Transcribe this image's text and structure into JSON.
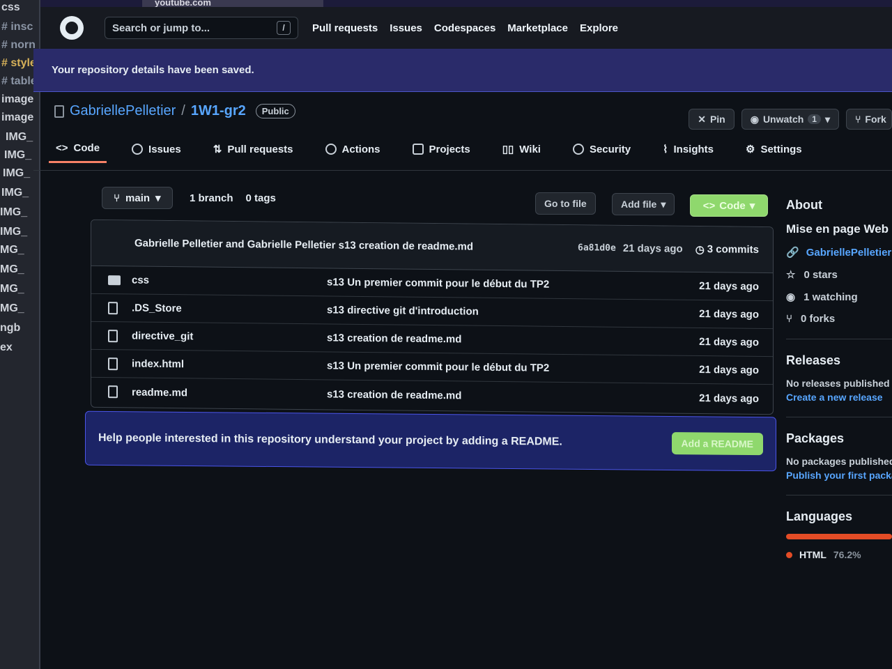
{
  "editor": {
    "lines": [
      "css",
      "# insc",
      "# norn",
      "# style",
      "# table",
      "image",
      "image",
      "IMG_",
      "IMG_",
      "IMG_",
      "IMG_",
      "IMG_",
      "IMG_",
      "MG_",
      "MG_",
      "MG_",
      "MG_",
      "ngb",
      "ex"
    ]
  },
  "browser": {
    "tab_popup": "youtube.com"
  },
  "header": {
    "search_placeholder": "Search or jump to...",
    "search_shortcut": "/",
    "nav": [
      "Pull requests",
      "Issues",
      "Codespaces",
      "Marketplace",
      "Explore"
    ]
  },
  "flash": {
    "message": "Your repository details have been saved."
  },
  "repo": {
    "owner": "GabriellePelletier",
    "separator": "/",
    "name": "1W1-gr2",
    "visibility": "Public",
    "actions": {
      "pin": "Pin",
      "unwatch": "Unwatch",
      "watch_count": "1",
      "fork": "Fork"
    }
  },
  "tabs": [
    "Code",
    "Issues",
    "Pull requests",
    "Actions",
    "Projects",
    "Wiki",
    "Security",
    "Insights",
    "Settings"
  ],
  "branch": {
    "current": "main",
    "branches": "1 branch",
    "tags": "0 tags",
    "goto_file": "Go to file",
    "add_file": "Add file",
    "code": "Code"
  },
  "latest_commit": {
    "authors": "Gabrielle Pelletier and Gabrielle Pelletier s13 creation de readme.md",
    "sha": "6a81d0e",
    "when": "21 days ago",
    "commits": "3 commits"
  },
  "files": [
    {
      "type": "folder",
      "name": "css",
      "message": "s13 Un premier commit pour le début du TP2",
      "date": "21 days ago"
    },
    {
      "type": "file",
      "name": ".DS_Store",
      "message": "s13 directive git d'introduction",
      "date": "21 days ago"
    },
    {
      "type": "file",
      "name": "directive_git",
      "message": "s13 creation de readme.md",
      "date": "21 days ago"
    },
    {
      "type": "file",
      "name": "index.html",
      "message": "s13 Un premier commit pour le début du TP2",
      "date": "21 days ago"
    },
    {
      "type": "file",
      "name": "readme.md",
      "message": "s13 creation de readme.md",
      "date": "21 days ago"
    }
  ],
  "readme_banner": {
    "text": "Help people interested in this repository understand your project by adding a README.",
    "button": "Add a README"
  },
  "sidebar": {
    "about_title": "About",
    "description": "Mise en page Web",
    "link": "GabriellePelletier",
    "stars": "0 stars",
    "watching": "1 watching",
    "forks": "0 forks",
    "releases_title": "Releases",
    "releases_none": "No releases published",
    "releases_link": "Create a new release",
    "packages_title": "Packages",
    "packages_none": "No packages published",
    "packages_link": "Publish your first package",
    "languages_title": "Languages",
    "language_name": "HTML",
    "language_pct": "76.2%"
  },
  "colors": {
    "accent": "#58a6ff",
    "code_button": "#8fd86d",
    "flash_bg": "#2a2b6a",
    "html_lang": "#e34c26"
  }
}
